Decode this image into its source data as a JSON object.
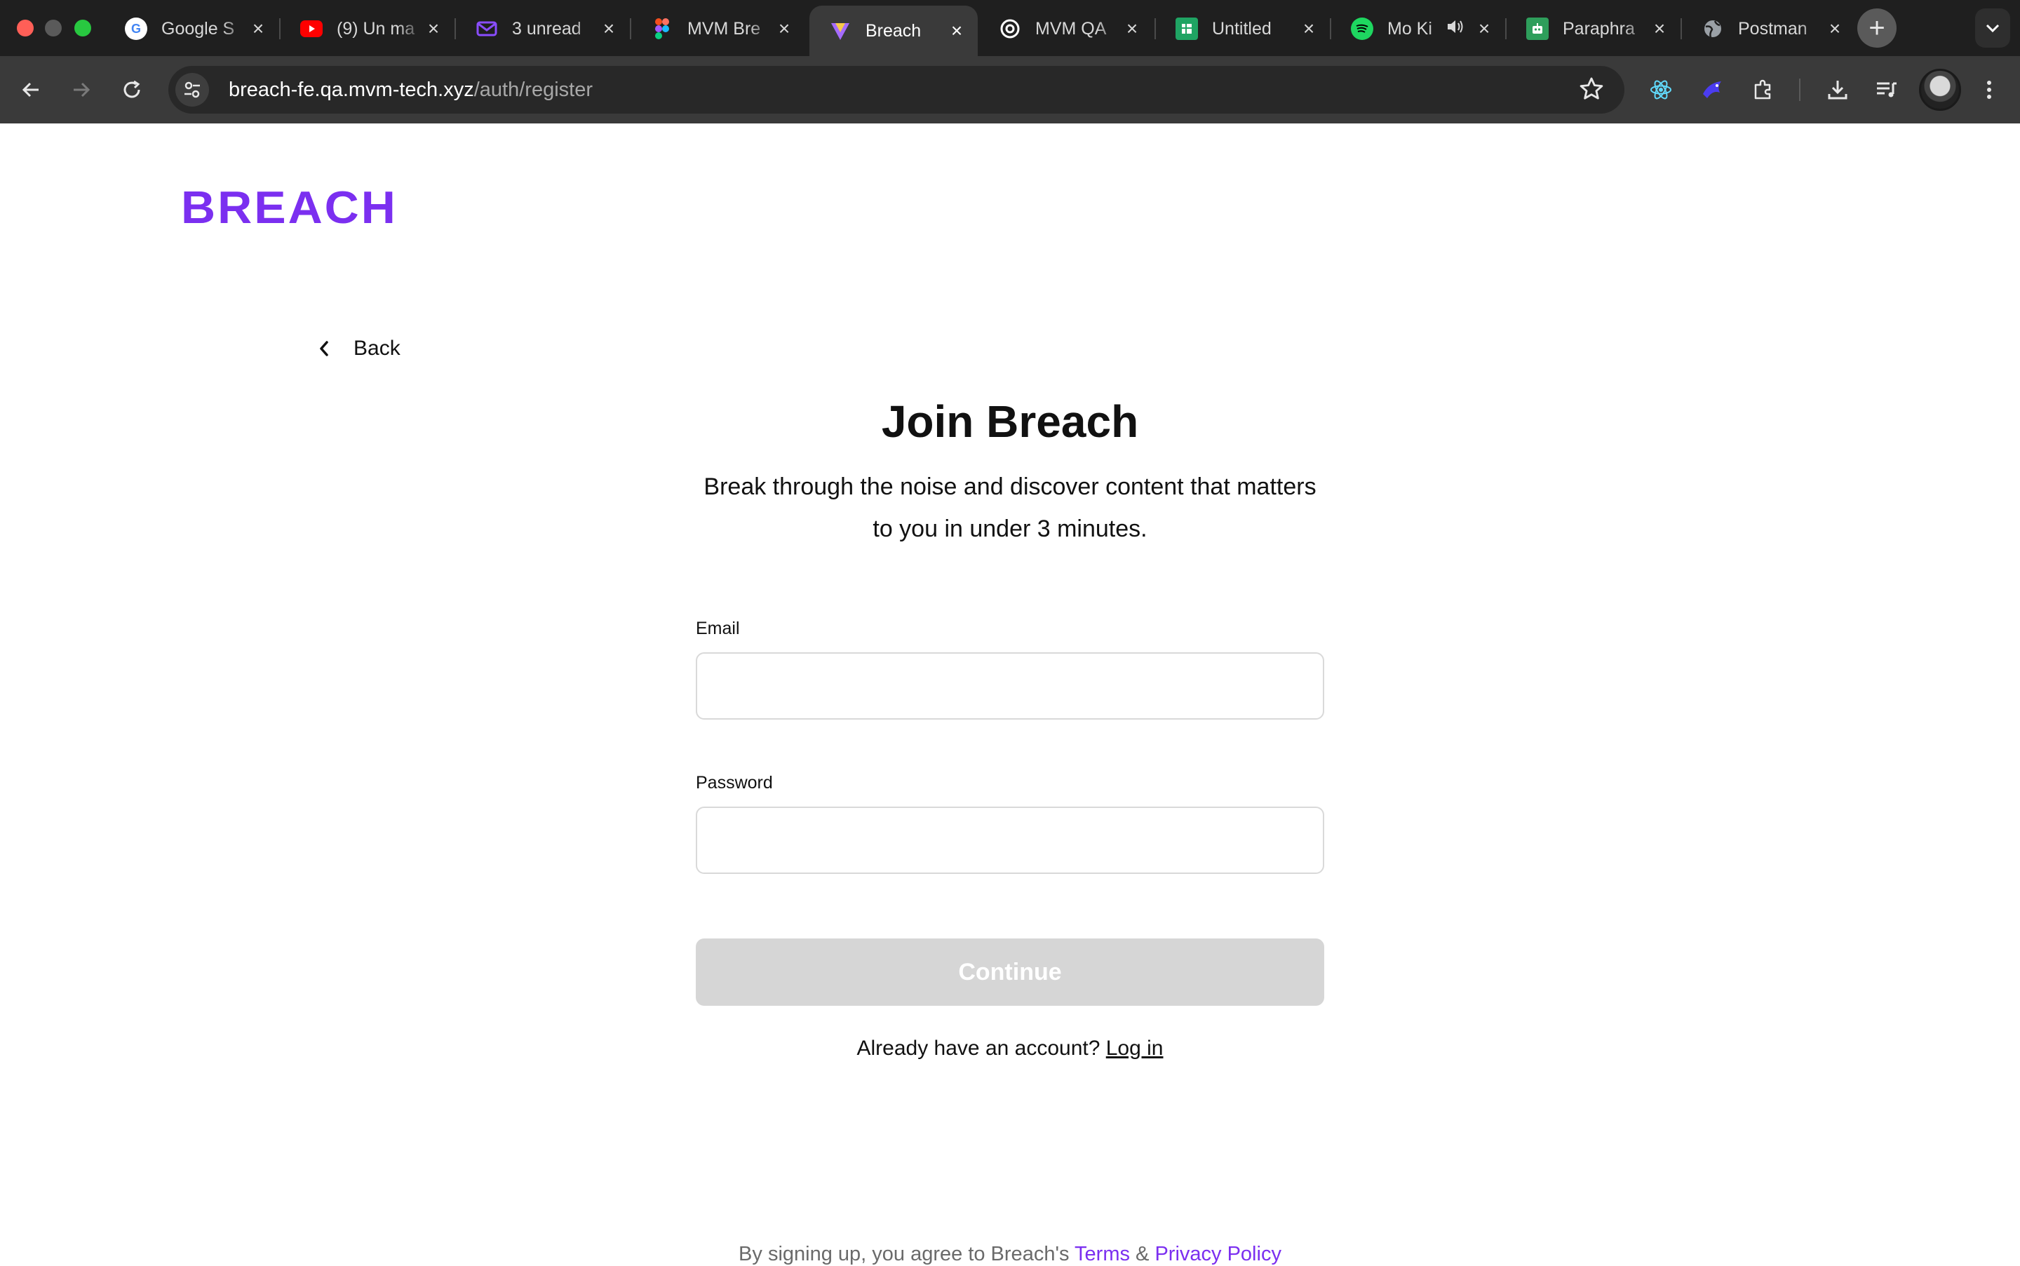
{
  "browser": {
    "tabs": [
      {
        "title": "Google S",
        "icon": "google-icon",
        "color": "#ffffff"
      },
      {
        "title": "(9) Un ma",
        "icon": "youtube-icon",
        "color": "#ff0000"
      },
      {
        "title": "3 unread",
        "icon": "mail-icon",
        "color": "#8a4dff"
      },
      {
        "title": "MVM Bre",
        "icon": "figma-icon",
        "color": "#f24e1e"
      },
      {
        "title": "Breach",
        "icon": "breach-icon",
        "color": "#7b2ff0"
      },
      {
        "title": "MVM QA",
        "icon": "openai-icon",
        "color": "#ffffff"
      },
      {
        "title": "Untitled",
        "icon": "sheets-icon",
        "color": "#1fa463"
      },
      {
        "title": "Mo Ki",
        "icon": "spotify-icon",
        "color": "#1ed760"
      },
      {
        "title": "Paraphra",
        "icon": "bot-icon",
        "color": "#2e9e5b"
      },
      {
        "title": "Postman",
        "icon": "globe-icon",
        "color": "#9aa0a6"
      }
    ],
    "url_host": "breach-fe.qa.mvm-tech.xyz",
    "url_path": "/auth/register"
  },
  "page": {
    "logo": "BREACH",
    "back_label": "Back",
    "heading": "Join Breach",
    "subtitle": "Break through the noise and discover content that matters to you in under 3 minutes.",
    "email_label": "Email",
    "email_value": "",
    "password_label": "Password",
    "password_value": "",
    "continue_label": "Continue",
    "already_text": "Already have an account?",
    "login_label": "Log in",
    "terms_prefix": "By signing up, you agree to Breach's",
    "terms_label": "Terms",
    "terms_amp": "&",
    "privacy_label": "Privacy Policy"
  },
  "colors": {
    "brand": "#7b2ff0",
    "button_disabled": "#d6d6d6",
    "field_border": "#d9d9d9"
  }
}
